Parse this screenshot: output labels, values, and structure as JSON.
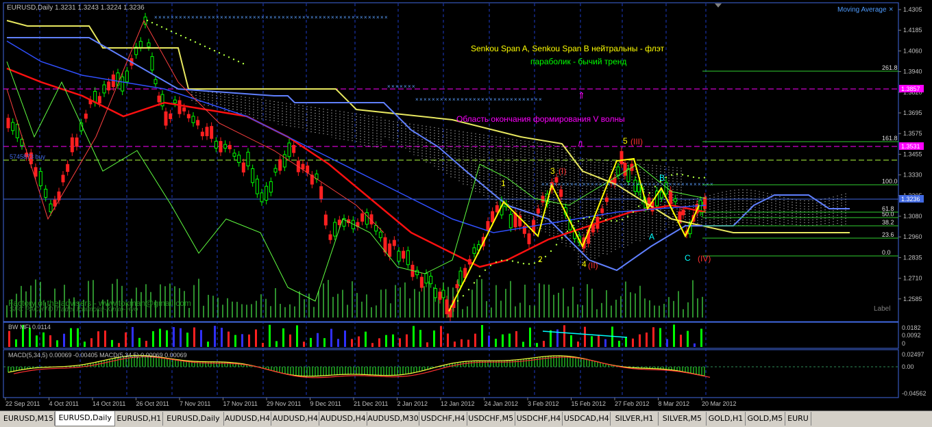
{
  "window": {
    "symbol_info": "EURUSD,Daily  1.3231 1.3243 1.3224 1.3236",
    "indicator_name": "Moving Average",
    "close_symbol": "×",
    "corner_label": "Label"
  },
  "colors": {
    "background": "#000000",
    "frame": "#4169e1",
    "price_axis_text": "#c0c0c0",
    "magenta": "#ff00ff",
    "yellow": "#ffff00",
    "lime": "#00ff00",
    "red": "#ff0000",
    "blue": "#4f6bff",
    "cyan": "#00ffff"
  },
  "price_axis": {
    "labels": [
      "1.4305",
      "1.4185",
      "1.4060",
      "1.3940",
      "1.3820",
      "1.3695",
      "1.3575",
      "1.3455",
      "1.3330",
      "1.3205",
      "1.3080",
      "1.2960",
      "1.2835",
      "1.2710",
      "1.2585"
    ],
    "markers": [
      {
        "text": "1.3857",
        "color": "#ff00ff"
      },
      {
        "text": "1.3531",
        "color": "#ff00ff"
      },
      {
        "text": "1.3236",
        "color": "#4169e1"
      }
    ]
  },
  "time_axis": {
    "labels": [
      "22 Sep 2011",
      "4 Oct 2011",
      "14 Oct 2011",
      "26 Oct 2011",
      "7 Nov 2011",
      "17 Nov 2011",
      "29 Nov 2011",
      "9 Dec 2011",
      "21 Dec 2011",
      "2 Jan 2012",
      "12 Jan 2012",
      "24 Jan 2012",
      "3 Feb 2012",
      "15 Feb 2012",
      "27 Feb 2012",
      "8 Mar 2012",
      "20 Mar 2012"
    ]
  },
  "annotations": {
    "senkou": "Senkou Span A, Senkou Span B нейтральны - флэт",
    "parabolic": "параболик - бычий тренд",
    "wave_zone": "Область окончания формирования V волны",
    "order_label": "5745873  buy",
    "factory": "Factory of the advisers - www.tokman@gmail.com",
    "factory2": "SFC  PACHTO  Trader  Ichimoku-Kinko-Hyo",
    "arrow_glyph": "⇑",
    "pi_glyph": "Л"
  },
  "waves": {
    "w1": "1",
    "w2": "2",
    "w3": "3",
    "w4": "4",
    "w5": "5",
    "wI": "(I)",
    "wII": "(II)",
    "wIII": "(III)",
    "wIV": "(IV)",
    "A": "A",
    "B": "B",
    "C": "C"
  },
  "fibo_levels": [
    {
      "label": "261.8"
    },
    {
      "label": "161.8"
    },
    {
      "label": "100.0"
    },
    {
      "label": "61.8"
    },
    {
      "label": "50.0"
    },
    {
      "label": "38.2"
    },
    {
      "label": "23.6"
    },
    {
      "label": "0.0"
    }
  ],
  "mfi": {
    "label": "BW MFI 0.0114",
    "axis": [
      "0.0182",
      "0.0092",
      "0"
    ]
  },
  "macd": {
    "label": "MACD(5,34,5) 0.00069 -0.00405  MACD(5,34,5) 0.00069 0.00069",
    "axis": [
      "0.02497",
      "0.00",
      "-0.04562"
    ]
  },
  "tabs": [
    {
      "label": "EURUSD,M15",
      "active": false
    },
    {
      "label": "EURUSD,Daily",
      "active": true
    },
    {
      "label": "EURUSD,H1",
      "active": false
    },
    {
      "label": "EURUSD,Daily",
      "active": false
    },
    {
      "label": "AUDUSD,H4",
      "active": false
    },
    {
      "label": "AUDUSD,H4",
      "active": false
    },
    {
      "label": "AUDUSD,H4",
      "active": false
    },
    {
      "label": "AUDUSD,M30",
      "active": false
    },
    {
      "label": "USDCHF,H4",
      "active": false
    },
    {
      "label": "USDCHF,M5",
      "active": false
    },
    {
      "label": "USDCHF,H4",
      "active": false
    },
    {
      "label": "USDCAD,H4",
      "active": false
    },
    {
      "label": "SILVER,H1",
      "active": false
    },
    {
      "label": "SILVER,M5",
      "active": false
    },
    {
      "label": "GOLD,H1",
      "active": false
    },
    {
      "label": "GOLD,M5",
      "active": false
    },
    {
      "label": "EURU",
      "active": false
    }
  ]
}
